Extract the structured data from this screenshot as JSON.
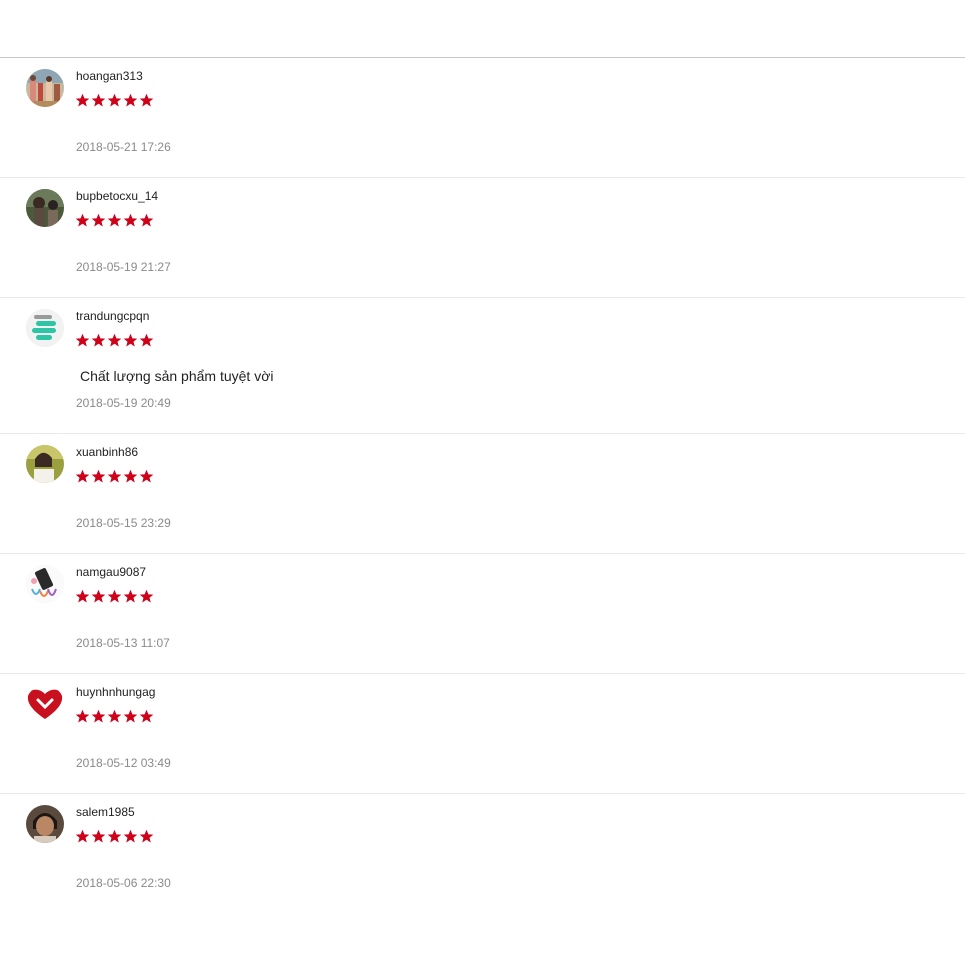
{
  "star_color": "#d0011b",
  "reviews": [
    {
      "username": "hoangan313",
      "rating": 5,
      "comment": "",
      "timestamp": "2018-05-21 17:26",
      "avatar_icon": "family-photo-avatar"
    },
    {
      "username": "bupbetocxu_14",
      "rating": 5,
      "comment": "",
      "timestamp": "2018-05-19 21:27",
      "avatar_icon": "outdoor-photo-avatar"
    },
    {
      "username": "trandungcpqn",
      "rating": 5,
      "comment": " Chất lượng sản phẩm tuyệt vời",
      "timestamp": "2018-05-19 20:49",
      "avatar_icon": "chat-bubbles-avatar"
    },
    {
      "username": "xuanbinh86",
      "rating": 5,
      "comment": "",
      "timestamp": "2018-05-15 23:29",
      "avatar_icon": "portrait-photo-avatar"
    },
    {
      "username": "namgau9087",
      "rating": 5,
      "comment": "",
      "timestamp": "2018-05-13 11:07",
      "avatar_icon": "phone-ribbon-avatar"
    },
    {
      "username": "huynhnhungag",
      "rating": 5,
      "comment": "",
      "timestamp": "2018-05-12 03:49",
      "avatar_icon": "red-heart-avatar"
    },
    {
      "username": "salem1985",
      "rating": 5,
      "comment": "",
      "timestamp": "2018-05-06 22:30",
      "avatar_icon": "child-portrait-avatar"
    }
  ]
}
